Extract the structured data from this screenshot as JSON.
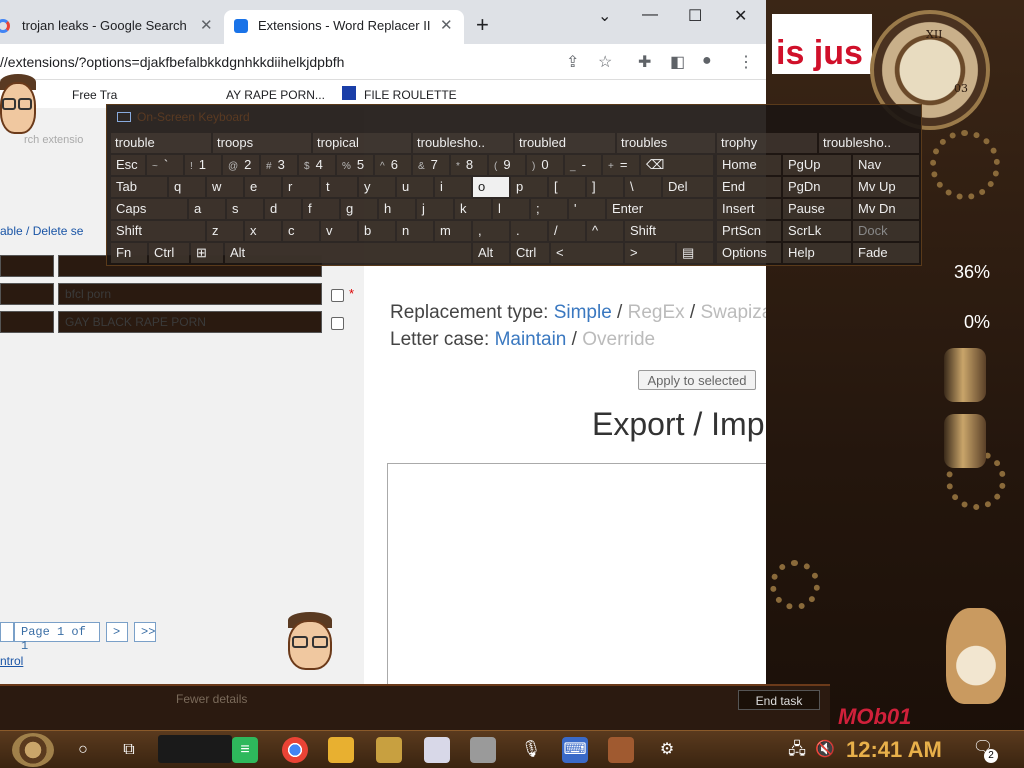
{
  "browser": {
    "tabs": [
      {
        "label": "trojan leaks - Google Search"
      },
      {
        "label": "Extensions - Word Replacer II"
      }
    ],
    "new_tab": "+",
    "controls": {
      "minimize": "—",
      "maximize": "☐",
      "close": "✕",
      "chevron": "⌄"
    },
    "url": "//extensions/?options=djakfbefalbkkdgnhkkdiihelkjdpbfh",
    "bookmarks": [
      "Free Tra",
      "AY RAPE PORN...",
      "FILE ROULETTE"
    ]
  },
  "page": {
    "hidden_text": "rch extensio",
    "enable_links": {
      "enable": "able",
      "sep": " / ",
      "delete": "Delete se"
    },
    "rows": [
      {
        "field": "bfcl porn"
      },
      {
        "field": "GAY BLACK RAPE PORN"
      }
    ],
    "required_mark": "*",
    "replacement_type": {
      "label": "Replacement type: ",
      "simple": "Simple",
      "sep": " / ",
      "regex": "RegEx",
      "swap": "Swapization"
    },
    "letter_case": {
      "label": "Letter case: ",
      "maintain": "Maintain",
      "sep": " / ",
      "override": "Override"
    },
    "apply_button": "Apply to selected",
    "export_title": "Export / Imp",
    "pager": {
      "first": "",
      "page_label": "Page 1 of 1",
      "next": ">",
      "last": ">>"
    },
    "control_link": "ntrol"
  },
  "taskmgr": {
    "fewer_details": "Fewer details",
    "end_task": "End task"
  },
  "desktop": {
    "banner": "is jus",
    "pct1": "36%",
    "pct2": "0%",
    "clock_numerals": {
      "top": "XII",
      "badge": "03"
    },
    "logo_text": "MOb01"
  },
  "osk": {
    "title": "On-Screen Keyboard",
    "suggestions": [
      "trouble",
      "troops",
      "tropical",
      "troublesho..",
      "troubled",
      "troubles",
      "trophy",
      "troublesho.."
    ],
    "row1": [
      {
        "main": "Esc"
      },
      {
        "sub": "~",
        "main": "`"
      },
      {
        "sub": "!",
        "main": "1"
      },
      {
        "sub": "@",
        "main": "2"
      },
      {
        "sub": "#",
        "main": "3"
      },
      {
        "sub": "$",
        "main": "4"
      },
      {
        "sub": "%",
        "main": "5"
      },
      {
        "sub": "^",
        "main": "6"
      },
      {
        "sub": "&",
        "main": "7"
      },
      {
        "sub": "*",
        "main": "8"
      },
      {
        "sub": "(",
        "main": "9"
      },
      {
        "sub": ")",
        "main": "0"
      },
      {
        "sub": "_",
        "main": "-"
      },
      {
        "sub": "+",
        "main": "="
      },
      {
        "main": "⌫"
      }
    ],
    "row2": [
      "Tab",
      "q",
      "w",
      "e",
      "r",
      "t",
      "y",
      "u",
      "i",
      "o",
      "p",
      "[",
      "]",
      "\\",
      "Del"
    ],
    "row3": [
      "Caps",
      "a",
      "s",
      "d",
      "f",
      "g",
      "h",
      "j",
      "k",
      "l",
      ";",
      "'",
      "Enter"
    ],
    "row4": [
      "Shift",
      "z",
      "x",
      "c",
      "v",
      "b",
      "n",
      "m",
      ",",
      ".",
      "/",
      "^",
      "Shift"
    ],
    "row5": [
      "Fn",
      "Ctrl",
      "⊞",
      "Alt",
      "Alt",
      "Ctrl",
      "<",
      ">",
      "▤"
    ],
    "nav": [
      [
        "Home",
        "PgUp",
        "Nav"
      ],
      [
        "End",
        "PgDn",
        "Mv Up"
      ],
      [
        "Insert",
        "Pause",
        "Mv Dn"
      ],
      [
        "PrtScn",
        "ScrLk",
        "Dock"
      ],
      [
        "Options",
        "Help",
        "Fade"
      ]
    ]
  },
  "taskbar": {
    "clock": "12:41 AM",
    "notification_count": "2",
    "items": [
      "cortana-icon",
      "task-view-icon",
      "notes-icon",
      "chrome-icon",
      "explorer-icon",
      "photo-icon",
      "doc-icon",
      "mask-icon",
      "mic-icon",
      "keyboard-icon",
      "game-icon",
      "settings-icon"
    ]
  }
}
